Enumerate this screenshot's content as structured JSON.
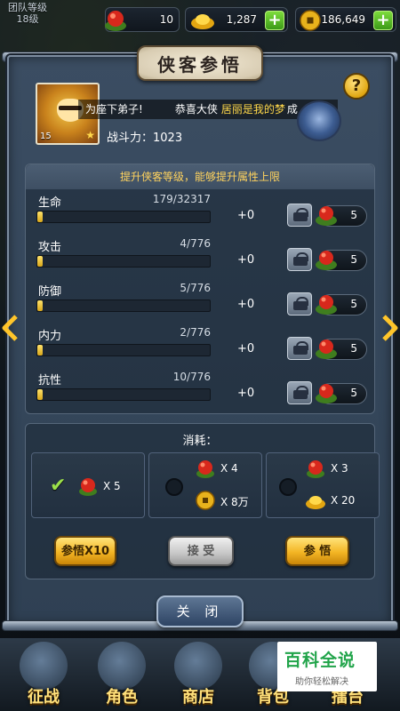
{
  "topbar": {
    "team_level_label": "团队等级",
    "team_level_value": "18级",
    "peach_count": "10",
    "gold_ingot_count": "1,287",
    "coin_count": "186,649"
  },
  "dialog": {
    "title": "侠客参悟",
    "help_label": "?",
    "hero_level": "15",
    "marquee": {
      "part1": "为座下弟子!",
      "part2": "恭喜大侠",
      "player": "居丽是我的梦",
      "part3": "成"
    },
    "combat_power": "战斗力：1023",
    "attr_header": "提升侠客等级，能够提升属性上限",
    "attributes": [
      {
        "name": "生命",
        "value": "179/32317",
        "progress": 0.0055,
        "bonus": "+0",
        "cost": "5"
      },
      {
        "name": "攻击",
        "value": "4/776",
        "progress": 0.0052,
        "bonus": "+0",
        "cost": "5"
      },
      {
        "name": "防御",
        "value": "5/776",
        "progress": 0.0064,
        "bonus": "+0",
        "cost": "5"
      },
      {
        "name": "内力",
        "value": "2/776",
        "progress": 0.0026,
        "bonus": "+0",
        "cost": "5"
      },
      {
        "name": "抗性",
        "value": "10/776",
        "progress": 0.0129,
        "bonus": "+0",
        "cost": "5"
      }
    ],
    "consume_title": "消耗：",
    "options": {
      "opt1_peach": "X 5",
      "opt2_peach": "X 4",
      "opt2_coin": "X 8万",
      "opt3_peach": "X 3",
      "opt3_gold": "X 20"
    },
    "buttons": {
      "ten": "参悟X10",
      "accept": "接 受",
      "once": "参 悟"
    },
    "close_label": "关 闭"
  },
  "bottom_nav": {
    "items": [
      "征战",
      "角色",
      "商店",
      "背包",
      "擂台"
    ]
  },
  "watermark": {
    "title": "百科全说",
    "subtitle": "助你轻松解决"
  },
  "colors": {
    "accent_gold": "#ffd35e",
    "player_name": "#ffd84a",
    "check_green": "#9be04a"
  }
}
